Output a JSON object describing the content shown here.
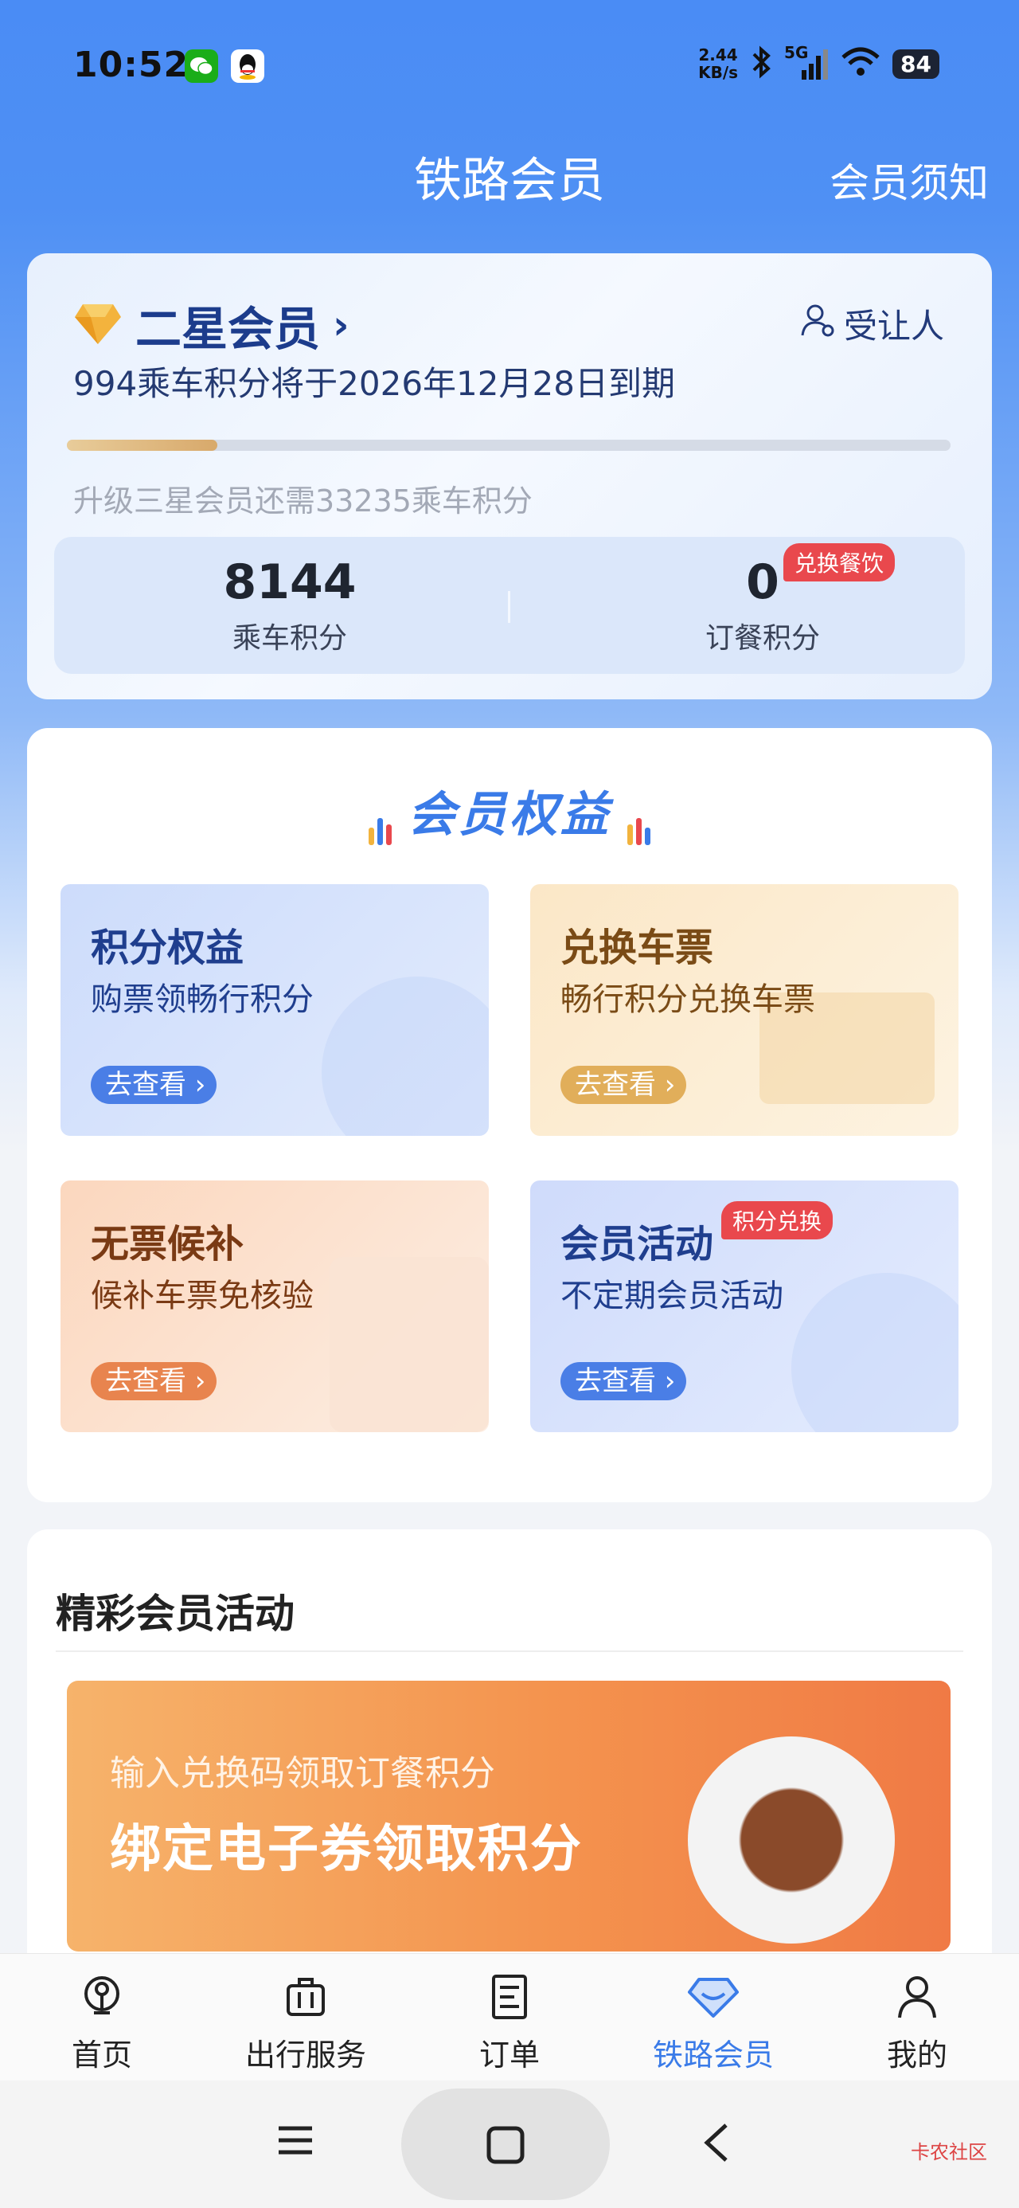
{
  "status_bar": {
    "time": "10:52",
    "speed_value": "2.44",
    "speed_unit": "KB/s",
    "network": "5G",
    "battery": "84"
  },
  "nav": {
    "title": "铁路会员",
    "right_link": "会员须知"
  },
  "member_card": {
    "level": "二星会员",
    "transferee_label": "受让人",
    "expiry_text": "994乘车积分将于2026年12月28日到期",
    "progress_fraction": 0.17,
    "upgrade_text": "升级三星会员还需33235乘车积分",
    "ride_points": {
      "value": "8144",
      "label": "乘车积分"
    },
    "meal_points": {
      "value": "0",
      "label": "订餐积分",
      "badge": "兑换餐饮"
    }
  },
  "benefits": {
    "title": "会员权益",
    "tiles": [
      {
        "title": "积分权益",
        "subtitle": "购票领畅行积分",
        "button": "去查看"
      },
      {
        "title": "兑换车票",
        "subtitle": "畅行积分兑换车票",
        "button": "去查看"
      },
      {
        "title": "无票候补",
        "subtitle": "候补车票免核验",
        "button": "去查看"
      },
      {
        "title": "会员活动",
        "subtitle": "不定期会员活动",
        "button": "去查看",
        "badge": "积分兑换"
      }
    ]
  },
  "activities": {
    "title": "精彩会员活动",
    "banner_sub": "输入兑换码领取订餐积分",
    "banner_main": "绑定电子券领取积分"
  },
  "tabbar": {
    "items": [
      {
        "label": "首页",
        "icon": "railway-logo-icon"
      },
      {
        "label": "出行服务",
        "icon": "luggage-icon"
      },
      {
        "label": "订单",
        "icon": "order-icon"
      },
      {
        "label": "铁路会员",
        "icon": "diamond-icon"
      },
      {
        "label": "我的",
        "icon": "user-icon"
      }
    ],
    "active_index": 3
  },
  "watermark": "卡农社区",
  "colors": {
    "brand_blue": "#4a8cf5",
    "active_tab": "#3a7be8",
    "badge_red": "#e9484d"
  }
}
